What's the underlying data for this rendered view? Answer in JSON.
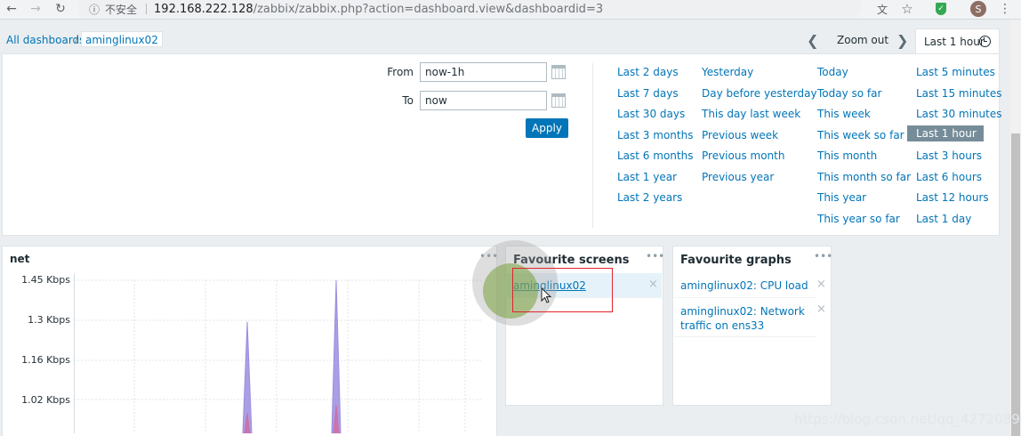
{
  "browser": {
    "insecure_label": "不安全",
    "url_host": "192.168.222.128",
    "url_path": "/zabbix/zabbix.php?action=dashboard.view&dashboardid=3",
    "avatar_letter": "S"
  },
  "breadcrumb": {
    "all_dashboards": "All dashboards",
    "separator": "/",
    "current": "aminglinux02"
  },
  "time_controls": {
    "zoom_out": "Zoom out",
    "range_tab": "Last 1 hour"
  },
  "filter": {
    "from_label": "From",
    "from_value": "now-1h",
    "to_label": "To",
    "to_value": "now",
    "apply_label": "Apply",
    "quick_ranges": {
      "col1": [
        "Last 2 days",
        "Last 7 days",
        "Last 30 days",
        "Last 3 months",
        "Last 6 months",
        "Last 1 year",
        "Last 2 years"
      ],
      "col2": [
        "Yesterday",
        "Day before yesterday",
        "This day last week",
        "Previous week",
        "Previous month",
        "Previous year"
      ],
      "col3": [
        "Today",
        "Today so far",
        "This week",
        "This week so far",
        "This month",
        "This month so far",
        "This year",
        "This year so far"
      ],
      "col4": [
        "Last 5 minutes",
        "Last 15 minutes",
        "Last 30 minutes",
        "Last 1 hour",
        "Last 3 hours",
        "Last 6 hours",
        "Last 12 hours",
        "Last 1 day"
      ]
    },
    "selected_range": "Last 1 hour"
  },
  "widgets": {
    "net": {
      "title": "net",
      "dots": "•••"
    },
    "fav_screens": {
      "title": "Favourite screens",
      "dots": "•••",
      "items": [
        "aminglinux02"
      ],
      "remove": "×"
    },
    "fav_graphs": {
      "title": "Favourite graphs",
      "dots": "•••",
      "items": [
        "aminglinux02: CPU load",
        "aminglinux02: Network traffic on ens33"
      ],
      "remove": "×"
    }
  },
  "chart_data": {
    "type": "area",
    "title": "",
    "xlabel": "",
    "ylabel": "",
    "y_ticks": [
      "1.45 Kbps",
      "1.3 Kbps",
      "1.16 Kbps",
      "1.02 Kbps"
    ],
    "ylim": [
      0.96,
      1.45
    ],
    "series": [
      {
        "color": "#9b8de0",
        "x": [
          0,
          1,
          2,
          3,
          4,
          5,
          6,
          7,
          8,
          9,
          10,
          11,
          12
        ],
        "values": [
          0.87,
          0.87,
          0.87,
          0.87,
          1.3,
          0.87,
          0.87,
          0.87,
          1.45,
          0.87,
          0.87,
          0.87,
          0.87
        ]
      },
      {
        "color": "#cc6fa8",
        "x": [
          0,
          1,
          2,
          3,
          4,
          5,
          6,
          7,
          8,
          9,
          10,
          11,
          12
        ],
        "values": [
          0.87,
          0.87,
          0.87,
          0.87,
          0.97,
          0.87,
          0.87,
          0.87,
          1.0,
          0.87,
          0.87,
          0.87,
          0.87
        ]
      }
    ],
    "grid": true
  },
  "colors": {
    "link": "#0275b8",
    "apply": "#0275b8",
    "selected_range_bg": "#768d99",
    "highlight_box": "#e2232b"
  },
  "watermark": "https://blog.csdn.net/qq_42720896"
}
